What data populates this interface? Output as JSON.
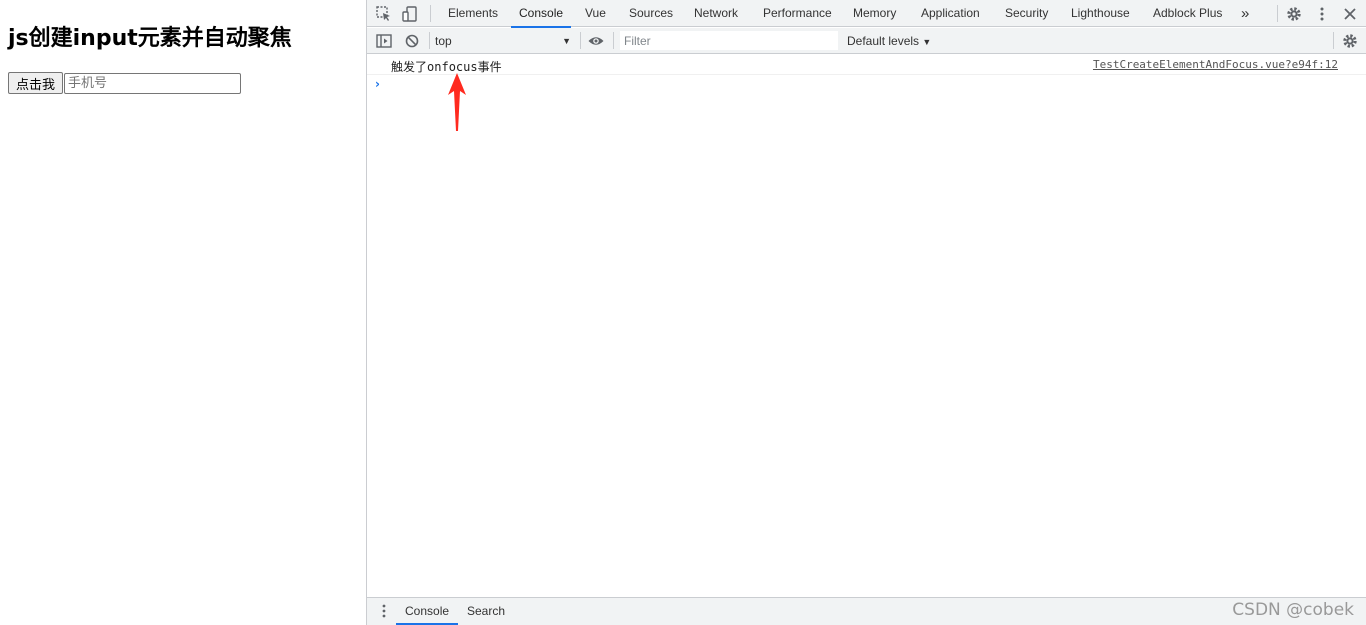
{
  "page": {
    "title": "js创建input元素并自动聚焦",
    "button_label": "点击我",
    "input_placeholder": "手机号",
    "input_value": ""
  },
  "devtools": {
    "tabs": [
      {
        "label": "Elements",
        "active": false
      },
      {
        "label": "Console",
        "active": true
      },
      {
        "label": "Vue",
        "active": false
      },
      {
        "label": "Sources",
        "active": false
      },
      {
        "label": "Network",
        "active": false
      },
      {
        "label": "Performance",
        "active": false
      },
      {
        "label": "Memory",
        "active": false
      },
      {
        "label": "Application",
        "active": false
      },
      {
        "label": "Security",
        "active": false
      },
      {
        "label": "Lighthouse",
        "active": false
      },
      {
        "label": "Adblock Plus",
        "active": false
      }
    ],
    "more_tabs_symbol": "»",
    "toolbar": {
      "context": "top",
      "filter_placeholder": "Filter",
      "filter_value": "",
      "levels_label": "Default levels"
    },
    "console": {
      "messages": [
        {
          "prefix": "触发了",
          "code": "onfocus",
          "suffix": "事件",
          "source": "TestCreateElementAndFocus.vue?e94f:12"
        }
      ],
      "prompt_symbol": "›"
    },
    "drawer": {
      "tabs": [
        {
          "label": "Console",
          "active": true
        },
        {
          "label": "Search",
          "active": false
        }
      ]
    }
  },
  "watermark": "CSDN @cobek",
  "colors": {
    "accent": "#1a73e8",
    "annotation_arrow": "#ff2a1f",
    "toolbar_bg": "#f1f3f4"
  }
}
